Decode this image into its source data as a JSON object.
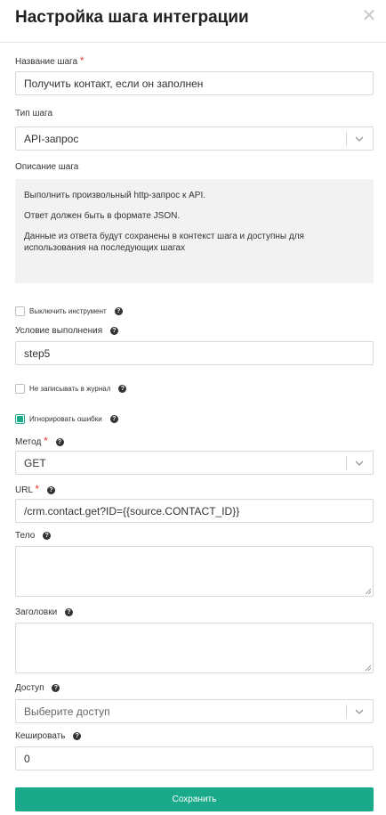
{
  "dialog": {
    "title": "Настройка шага интеграции",
    "close_icon": "close-icon"
  },
  "fields": {
    "step_name": {
      "label": "Название шага",
      "required_mark": "*",
      "value": "Получить контакт, если он заполнен"
    },
    "step_type": {
      "label": "Тип шага",
      "value": "API-запрос"
    },
    "description": {
      "label": "Описание шага",
      "lines": [
        "Выполнить произвольный http-запрос к API.",
        "Ответ должен быть в формате JSON.",
        "Данные из ответа будут сохранены в контекст шага и доступны для использования на последующих шагах"
      ]
    },
    "disable_tool": {
      "label": "Выключить инструмент",
      "checked": false,
      "help": "?"
    },
    "exec_condition": {
      "label": "Условие выполнения",
      "value": "step5",
      "help": "?"
    },
    "no_log": {
      "label": "Не записывать в журнал",
      "checked": false,
      "help": "?"
    },
    "ignore_errors": {
      "label": "Игнорировать ошибки",
      "checked": true,
      "help": "?"
    },
    "method": {
      "label": "Метод",
      "required_mark": "*",
      "value": "GET",
      "help": "?"
    },
    "url": {
      "label": "URL",
      "required_mark": "*",
      "value": "/crm.contact.get?ID={{source.CONTACT_ID}}",
      "help": "?"
    },
    "body": {
      "label": "Тело",
      "value": "",
      "help": "?"
    },
    "headers": {
      "label": "Заголовки",
      "value": "",
      "help": "?"
    },
    "access": {
      "label": "Доступ",
      "placeholder": "Выберите доступ",
      "help": "?"
    },
    "cache": {
      "label": "Кешировать",
      "value": "0",
      "help": "?"
    }
  },
  "actions": {
    "save_label": "Сохранить"
  },
  "colors": {
    "accent": "#1aaa8a",
    "required": "#e53935"
  }
}
